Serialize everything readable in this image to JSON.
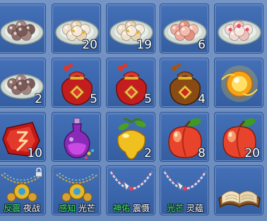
{
  "colors": {
    "slot_bg": "#3b66ac",
    "panel_bg": "#6e8fc0",
    "count_text": "#ffffff",
    "tag_green": "#3cf05a",
    "tag_white": "#ffffff"
  },
  "rows": [
    [
      {
        "icon": "dumplings-plate-icon",
        "count": ""
      },
      {
        "icon": "sweet-dumplings-plate-icon",
        "count": "20"
      },
      {
        "icon": "sweet-dumplings-plate-icon",
        "count": "19"
      },
      {
        "icon": "pink-dumplings-plate-icon",
        "count": "6"
      },
      {
        "icon": "flower-dumplings-plate-icon",
        "count": ""
      }
    ],
    [
      {
        "icon": "dumplings-plate-icon",
        "count": "2"
      },
      {
        "icon": "red-lucky-bag-icon",
        "count": "5"
      },
      {
        "icon": "red-lucky-bag-icon",
        "count": "5"
      },
      {
        "icon": "brown-lucky-bag-icon",
        "count": "4"
      },
      {
        "icon": "golden-orb-icon",
        "count": ""
      }
    ],
    [
      {
        "icon": "red-rune-stone-icon",
        "count": "10"
      },
      {
        "icon": "purple-potion-bottle-icon",
        "count": ""
      },
      {
        "icon": "golden-fruit-icon",
        "count": "2"
      },
      {
        "icon": "peach-icon",
        "count": "8"
      },
      {
        "icon": "peach-icon",
        "count": "20"
      }
    ],
    [
      {
        "icon": "gold-amulet-necklace-icon",
        "count": "",
        "tag_green": "反震",
        "tag_white": "夜战",
        "locked": true
      },
      {
        "icon": "gold-amulet-necklace-icon",
        "count": "",
        "tag_green": "感知",
        "tag_white": "光芒"
      },
      {
        "icon": "silver-chain-necklace-icon",
        "count": "",
        "tag_green": "神佑",
        "tag_white": "震慑"
      },
      {
        "icon": "silver-chain-necklace-icon",
        "count": "",
        "tag_green": "光芒",
        "tag_white": "灵蕴"
      },
      {
        "icon": "open-book-icon",
        "count": ""
      }
    ]
  ]
}
